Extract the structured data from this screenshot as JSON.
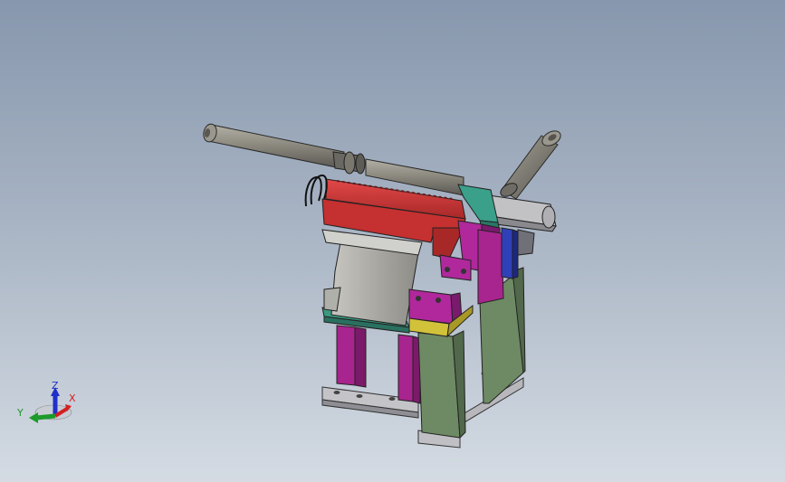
{
  "scene": {
    "background_top": "#8797ad",
    "background_bottom": "#d4dbe3"
  },
  "triad": {
    "x_label": "X",
    "y_label": "Y",
    "z_label": "Z",
    "x_color": "#d42020",
    "y_color": "#1c9a2a",
    "z_color": "#2030c8"
  },
  "parts": [
    {
      "name": "long-cylinder",
      "color": "#8a8880"
    },
    {
      "name": "short-cylinder",
      "color": "#8a8880"
    },
    {
      "name": "red-guide-bar",
      "color": "#c73434"
    },
    {
      "name": "magenta-bracket",
      "color": "#b0289c"
    },
    {
      "name": "teal-plate",
      "color": "#3a9a80"
    },
    {
      "name": "olive-leg",
      "color": "#6e8a64"
    },
    {
      "name": "yellow-spacer",
      "color": "#d2c23a"
    },
    {
      "name": "blue-block",
      "color": "#3040b8"
    },
    {
      "name": "gray-base",
      "color": "#b8b8bc"
    }
  ]
}
